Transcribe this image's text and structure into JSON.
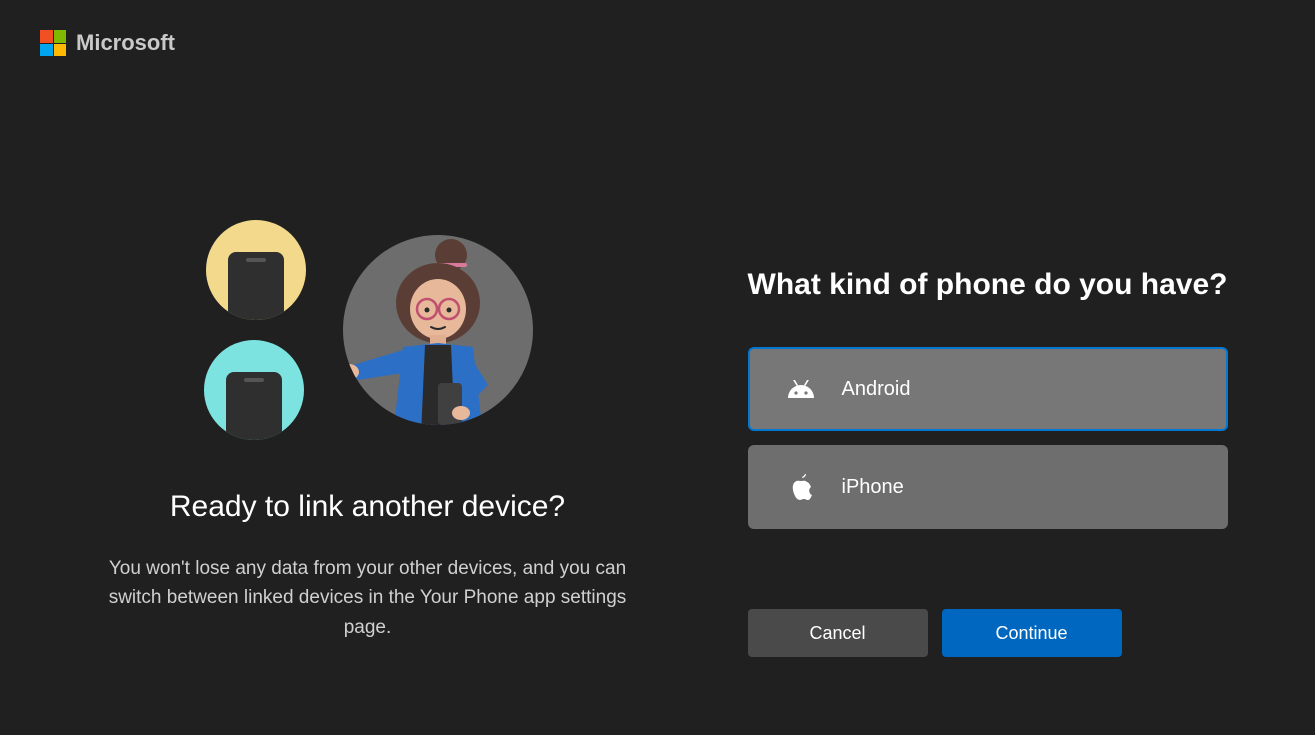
{
  "header": {
    "brand": "Microsoft"
  },
  "left": {
    "title": "Ready to link another device?",
    "description": "You won't lose any data from your other devices, and you can switch between linked devices in the Your Phone app settings page."
  },
  "right": {
    "title": "What kind of phone do you have?",
    "options": {
      "android": "Android",
      "iphone": "iPhone"
    },
    "buttons": {
      "cancel": "Cancel",
      "continue": "Continue"
    }
  }
}
